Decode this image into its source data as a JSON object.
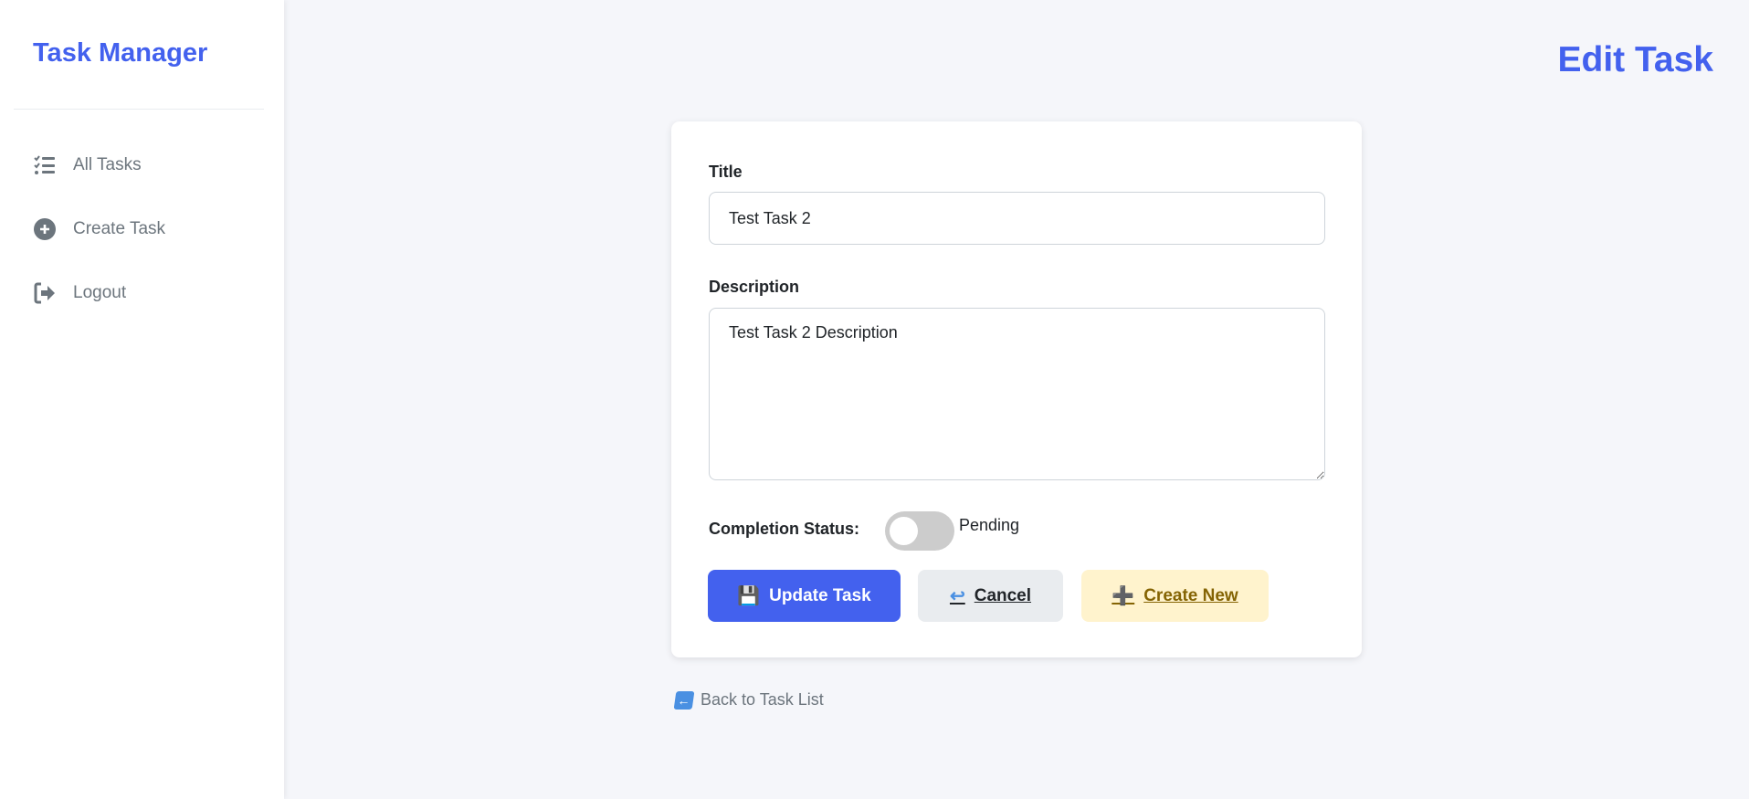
{
  "sidebar": {
    "brand": "Task Manager",
    "items": [
      {
        "label": "All Tasks",
        "icon": "list-check-icon"
      },
      {
        "label": "Create Task",
        "icon": "plus-circle-icon"
      },
      {
        "label": "Logout",
        "icon": "logout-icon"
      }
    ]
  },
  "header": {
    "title": "Edit Task"
  },
  "form": {
    "title_label": "Title",
    "title_value": "Test Task 2",
    "description_label": "Description",
    "description_value": "Test Task 2 Description",
    "status_label": "Completion Status:",
    "status_value": "Pending",
    "completed": false,
    "update_label": "Update Task",
    "update_icon": "💾",
    "cancel_label": "Cancel",
    "cancel_icon": "↩",
    "create_label": "Create New",
    "create_icon": "➕"
  },
  "back_link": {
    "label": "Back to Task List",
    "icon": "←"
  },
  "colors": {
    "accent": "#4361ee",
    "muted": "#6c757d",
    "warning_bg": "#fff3cd"
  }
}
